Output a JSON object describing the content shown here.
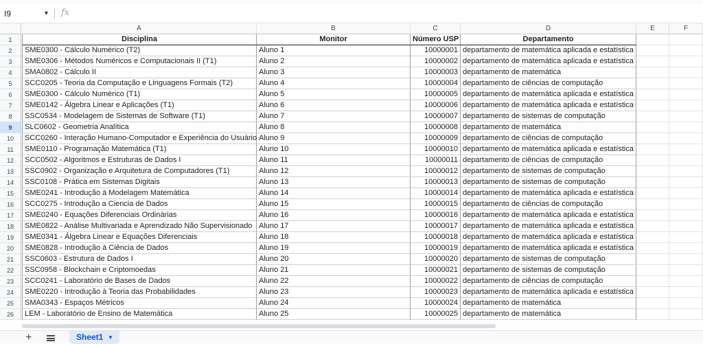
{
  "name_box": {
    "value": "I9"
  },
  "formula_bar": {
    "fx": "fx",
    "value": ""
  },
  "columns": [
    "A",
    "B",
    "C",
    "D",
    "E",
    "F"
  ],
  "selected_row": "9",
  "header_row": {
    "num": "1",
    "cells": [
      "Disciplina",
      "Monitor",
      "Número USP",
      "Departamento"
    ]
  },
  "rows": [
    {
      "num": "2",
      "cells": [
        "SME0300 - Cálculo Numérico (T2)",
        "Aluno 1",
        "10000001",
        "departamento de matemática aplicada e estatística"
      ]
    },
    {
      "num": "3",
      "cells": [
        "SME0306 - Métodos Numéricos e Computacionais II (T1)",
        "Aluno 2",
        "10000002",
        "departamento de matemática aplicada e estatística"
      ]
    },
    {
      "num": "4",
      "cells": [
        "SMA0802 - Cálculo II",
        "Aluno 3",
        "10000003",
        "departamento de matemática"
      ]
    },
    {
      "num": "5",
      "cells": [
        "SCC0205 - Teoria da Computação e Linguagens Formais (T2)",
        "Aluno 4",
        "10000004",
        "departamento de ciências de computação"
      ]
    },
    {
      "num": "6",
      "cells": [
        "SME0300 - Cálculo Numérico (T1)",
        "Aluno 5",
        "10000005",
        "departamento de matemática aplicada e estatística"
      ]
    },
    {
      "num": "7",
      "cells": [
        "SME0142 - Álgebra Linear e Aplicações (T1)",
        "Aluno 6",
        "10000006",
        "departamento de matemática aplicada e estatística"
      ]
    },
    {
      "num": "8",
      "cells": [
        "SSC0534 - Modelagem de Sistemas de Software (T1)",
        "Aluno 7",
        "10000007",
        "departamento de sistemas de computação"
      ]
    },
    {
      "num": "9",
      "cells": [
        "SLC0602 - Geometria Analítica",
        "Aluno 8",
        "10000008",
        "departamento de matemática"
      ]
    },
    {
      "num": "10",
      "cells": [
        "SCC0260 - Interação Humano-Computador e Experiência do Usuário",
        "Aluno 9",
        "10000009",
        "departamento de ciências de computação"
      ]
    },
    {
      "num": "11",
      "cells": [
        "SME0110 - Programação Matemática (T1)",
        "Aluno 10",
        "10000010",
        "departamento de matemática aplicada e estatística"
      ]
    },
    {
      "num": "12",
      "cells": [
        "SCC0502 - Algoritmos e Estruturas de Dados I",
        "Aluno 11",
        "10000011",
        "departamento de ciências de computação"
      ]
    },
    {
      "num": "13",
      "cells": [
        "SSC0902 - Organização e Arquitetura de Computadores (T1)",
        "Aluno 12",
        "10000012",
        "departamento de sistemas de computação"
      ]
    },
    {
      "num": "14",
      "cells": [
        "SSC0108 - Prática em Sistemas Digitais",
        "Aluno 13",
        "10000013",
        "departamento de sistemas de computação"
      ]
    },
    {
      "num": "15",
      "cells": [
        "SME0241 - Introdução à Modelagem Matemática",
        "Aluno 14",
        "10000014",
        "departamento de matemática aplicada e estatística"
      ]
    },
    {
      "num": "16",
      "cells": [
        "SCC0275 - Introdução a Ciencia de Dados",
        "Aluno 15",
        "10000015",
        "departamento de ciências de computação"
      ]
    },
    {
      "num": "17",
      "cells": [
        "SME0240 - Equações Diferenciais Ordinárias",
        "Aluno 16",
        "10000016",
        "departamento de matemática aplicada e estatística"
      ]
    },
    {
      "num": "18",
      "cells": [
        "SME0822 - Análise Multivariada e Aprendizado Não Supervisionado",
        "Aluno 17",
        "10000017",
        "departamento de matemática aplicada e estatística"
      ]
    },
    {
      "num": "19",
      "cells": [
        "SME0341 - Álgebra Linear e Equações Diferenciais",
        "Aluno 18",
        "10000018",
        "departamento de matemática aplicada e estatística"
      ]
    },
    {
      "num": "20",
      "cells": [
        "SME0828 - Introdução à Ciência de Dados",
        "Aluno 19",
        "10000019",
        "departamento de matemática aplicada e estatística"
      ]
    },
    {
      "num": "21",
      "cells": [
        "SSC0603 - Estrutura de Dados I",
        "Aluno 20",
        "10000020",
        "departamento de sistemas de computação"
      ]
    },
    {
      "num": "22",
      "cells": [
        "SSC0958 - Blockchain e Criptomoedas",
        "Aluno 21",
        "10000021",
        "departamento de sistemas de computação"
      ]
    },
    {
      "num": "23",
      "cells": [
        "SCC0241 - Laboratório de Bases de Dados",
        "Aluno 22",
        "10000022",
        "departamento de ciências de computação"
      ]
    },
    {
      "num": "24",
      "cells": [
        "SME0220 - Introdução à Teoria das Probabilidades",
        "Aluno 23",
        "10000023",
        "departamento de matemática aplicada e estatística"
      ]
    },
    {
      "num": "25",
      "cells": [
        "SMA0343 - Espaços Métricos",
        "Aluno 24",
        "10000024",
        "departamento de matemática"
      ]
    },
    {
      "num": "26",
      "cells": [
        "LEM - Laboratório de Ensino de Matemática",
        "Aluno 25",
        "10000025",
        "departamento de matemática"
      ]
    }
  ],
  "sheet_tabs": {
    "add_icon": "plus-icon",
    "list_icon": "menu-icon",
    "active": "Sheet1"
  }
}
